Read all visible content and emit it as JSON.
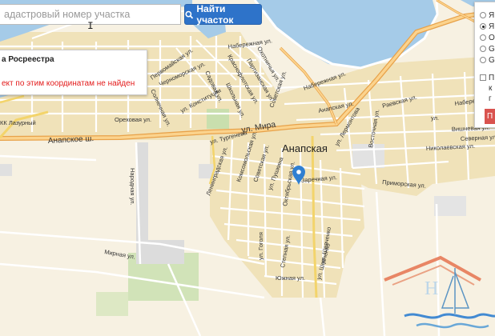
{
  "search": {
    "placeholder": "адастровый номер участка"
  },
  "find_button": {
    "label": "Найти участок",
    "icon": "search-icon"
  },
  "popup": {
    "title": "а Росреестра",
    "error": "ект по этим координатам не найден"
  },
  "layers_panel": {
    "options": [
      {
        "label": "Я",
        "selected": false
      },
      {
        "label": "Я",
        "selected": true
      },
      {
        "label": "О",
        "selected": false
      },
      {
        "label": "G",
        "selected": false
      },
      {
        "label": "G",
        "selected": false
      }
    ],
    "checkbox_label": "П",
    "extra": [
      "к",
      "г"
    ],
    "apply_label": "П"
  },
  "map": {
    "town": "Анапская",
    "pin_color": "#2f7fd1",
    "street_labels": [
      "ул. Мира",
      "Анапское ш.",
      "Набережная ул.",
      "Набережная ул.",
      "Набережная ул.",
      "Первомайская ул.",
      "Охотничья ул.",
      "Партизанская ул.",
      "Краснофлотская ул.",
      "Черноморская ул.",
      "Садовая ул.",
      "Школьная ул.",
      "ул. Конституции",
      "Солнечная ул.",
      "Ореховая ул.",
      "КК Лазурный",
      "Советская ул.",
      "Анапская ул.",
      "Раевская ул.",
      "Вишневая ул.",
      "Северная ул.",
      "Николаевская ул.",
      "Восточная ул.",
      "ул. Лермонтова",
      "Приморская ул.",
      "Заречная ул.",
      "ул. Тургенева",
      "Ленинградская ул.",
      "Комсомольская ул.",
      "Советская ул.",
      "ул. Пушкина",
      "Октябрьская ул.",
      "Народная ул.",
      "Мирная ул.",
      "ул. Гоголя",
      "Степная ул.",
      "ул. Шевченко",
      "Южная ул.",
      "ул. Шевченко",
      "ул."
    ]
  }
}
